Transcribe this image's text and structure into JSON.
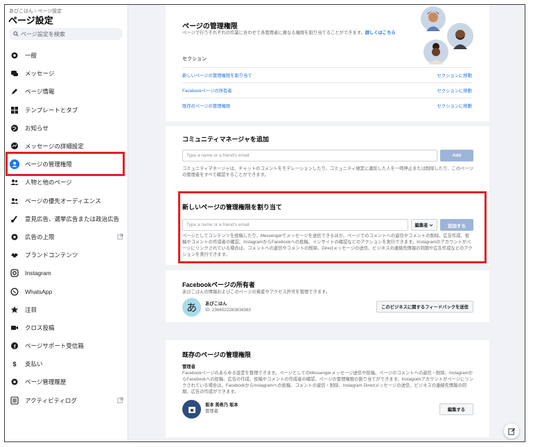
{
  "sidebar": {
    "breadcrumb": "あびこはん › ページ設定",
    "title": "ページ設定",
    "search_placeholder": "ページ設定を検索",
    "items": [
      {
        "label": "一般",
        "icon": "gear-icon"
      },
      {
        "label": "メッセージ",
        "icon": "chat-bubbles-icon"
      },
      {
        "label": "ページ情報",
        "icon": "pencil-icon"
      },
      {
        "label": "テンプレートとタブ",
        "icon": "grid-icon"
      },
      {
        "label": "お知らせ",
        "icon": "globe-icon"
      },
      {
        "label": "メッセージの詳細設定",
        "icon": "messenger-icon"
      },
      {
        "label": "ページの管理権限",
        "icon": "person-icon"
      },
      {
        "label": "人物と他のページ",
        "icon": "people-icon"
      },
      {
        "label": "ページの優先オーディエンス",
        "icon": "audience-icon"
      },
      {
        "label": "意見広告、選挙広告または政治広告",
        "icon": "megaphone-icon"
      },
      {
        "label": "広告の上限",
        "icon": "gear-icon"
      },
      {
        "label": "ブランドコンテンツ",
        "icon": "handshake-icon"
      },
      {
        "label": "Instagram",
        "icon": "instagram-icon"
      },
      {
        "label": "WhatsApp",
        "icon": "whatsapp-icon"
      },
      {
        "label": "注目",
        "icon": "star-icon"
      },
      {
        "label": "クロス投稿",
        "icon": "video-camera-icon"
      },
      {
        "label": "ページサポート受信箱",
        "icon": "facebook-icon"
      },
      {
        "label": "支払い",
        "icon": "dollar-icon"
      },
      {
        "label": "ページ管理履歴",
        "icon": "gear-icon"
      },
      {
        "label": "アクティビティログ",
        "icon": "list-icon"
      }
    ]
  },
  "page_roles": {
    "title": "ページの管理権限",
    "desc": "ページで行うそれぞれの作業に合わせて各管理者に異なる権限を割り当てることができます。",
    "desc_link": "詳しくはこちら",
    "section_label": "セクション",
    "rows": [
      {
        "label": "新しいページの管理権限を割り当て",
        "action": "セクションに移動"
      },
      {
        "label": "Facebookページの所有者",
        "action": "セクションに移動"
      },
      {
        "label": "既存のページの管理権限",
        "action": "セクションに移動"
      }
    ]
  },
  "community_manager": {
    "title": "コミュニティマネージャを追加",
    "input_placeholder": "Type a name or a friend's email",
    "add_button": "Add",
    "desc": "コミュニティマネージャは、チャットのコメントをモデレーションしたり、コミュニティ規定に違反した人を一時停止または削除したり、このページの管理者をすべて確認することができます。"
  },
  "assign_role": {
    "title": "新しいページの管理権限を割り当て",
    "input_placeholder": "Type a name or a friend's email",
    "role_select": "編集者",
    "add_button": "追加する",
    "desc": "ページとしてコンテンツを投稿したり、Messengerでメッセージを送信できるほか、ページでのコメントへの返信やコメントの削除、広告作成、投稿やコメントの作成者の確認、InstagramからFacebookへの投稿、インサイトの確認などのアクションを実行できます。Instagramのアカウントがページにリンクされている場合は、コメントへの返信やコメントの削除、Directメッセージの送信、ビジネスの連絡先情報の同期や広告作成などのアクションを実行できます。"
  },
  "owner": {
    "title": "Facebookページの所有者",
    "desc": "あびこはんの情報およびこのページの資産やアクセス許可を管理できます。",
    "avatar_letter": "あ",
    "name": "あびこはん",
    "id_text": "ID: 2364022263834383",
    "feedback_button": "このビジネスに関するフィードバックを送信"
  },
  "existing_roles": {
    "title": "既存のページの管理権限",
    "role_title": "管理者",
    "desc": "Facebookページのあらゆる設定を管理できます。ページとしてのMessengerメッセージ送信や投稿、ページのコメントへの返信・削除、InstagramからFacebookへの投稿、広告の作成、投稿やコメントの作成者の確認、ページの管理権限の割り当てができます。Instagramアカウントがページにリンクされている場合は、FacebookからInstagramへの投稿、コメントの返信・削除、Instagram Directメッセージの送信、ビジネスの連絡先情報の同期、広告の作成ができます。",
    "person_name": "坂本 美希乃 坂本",
    "person_role": "管理者",
    "edit_button": "編集する"
  },
  "colors": {
    "accent": "#1877f2",
    "link": "#216fdb",
    "highlight": "#e41e25"
  }
}
